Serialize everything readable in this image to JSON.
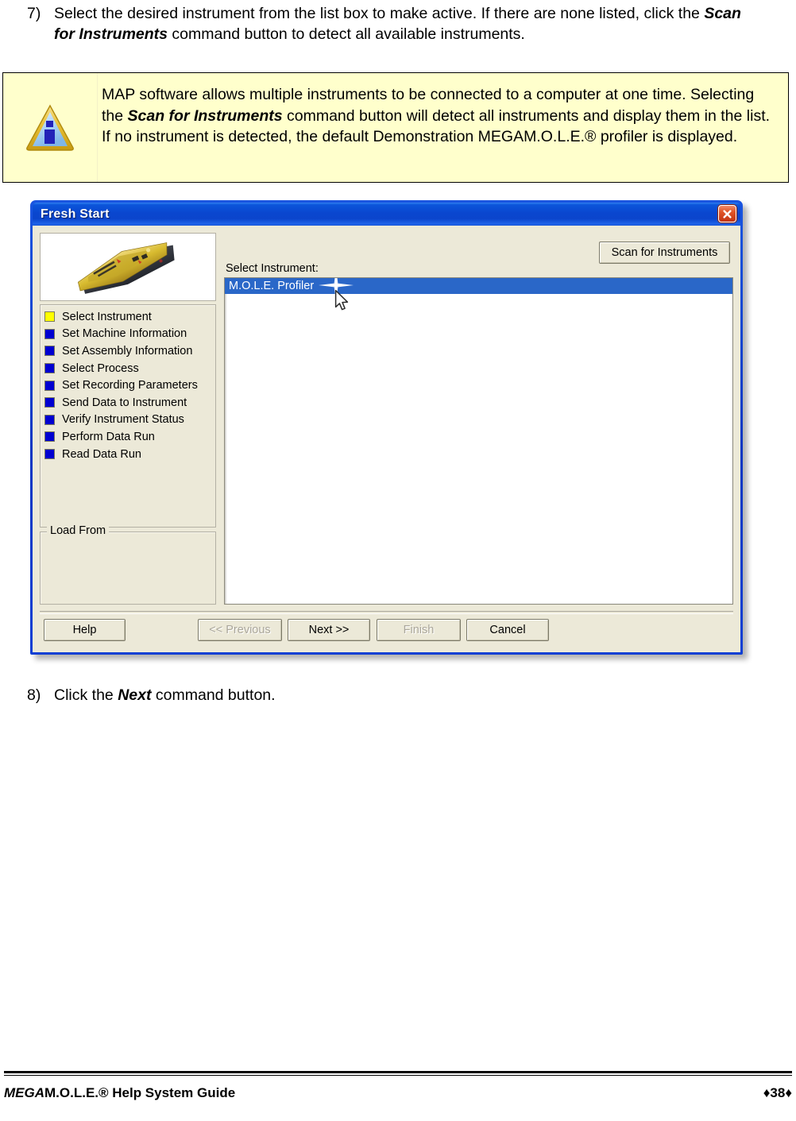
{
  "steps": [
    {
      "number": "7)",
      "text_1": "Select the desired instrument from the list box to make active. If there are none listed, click the ",
      "emphasis": "Scan for Instruments",
      "text_2": " command button to detect all available instruments."
    },
    {
      "number": "8)",
      "text_1": "Click the ",
      "emphasis": "Next",
      "text_2": " command button."
    }
  ],
  "note": {
    "icon": "info-triangle-icon",
    "text_1": "MAP software allows multiple instruments to be connected to a computer at one time. Selecting the ",
    "emphasis": "Scan for Instruments",
    "text_2": " command button will detect all instruments and display them in the list. If no instrument is detected, the default Demonstration MEGAM.O.L.E.® profiler is displayed.",
    "background_color": "#ffffcc",
    "border_color": "#000000"
  },
  "dialog": {
    "title": "Fresh Start",
    "close_icon": "close-icon",
    "titlebar_color": "#0b45cc",
    "face_color": "#ece9d8",
    "thumbnail_icon": "mole-profiler-device-image",
    "step_list": {
      "active_color": "#ffff00",
      "inactive_color": "#0000d0",
      "items": [
        {
          "label": "Select Instrument",
          "state": "active"
        },
        {
          "label": "Set Machine Information",
          "state": "pending"
        },
        {
          "label": "Set Assembly Information",
          "state": "pending"
        },
        {
          "label": "Select Process",
          "state": "pending"
        },
        {
          "label": "Set Recording Parameters",
          "state": "pending"
        },
        {
          "label": "Send Data to Instrument",
          "state": "pending"
        },
        {
          "label": "Verify Instrument Status",
          "state": "pending"
        },
        {
          "label": "Perform Data Run",
          "state": "pending"
        },
        {
          "label": "Read Data Run",
          "state": "pending"
        }
      ]
    },
    "load_from": {
      "legend": "Load From",
      "value": ""
    },
    "select_instrument": {
      "label": "Select Instrument:",
      "scan_button": "Scan for Instruments",
      "list_items": [
        {
          "label": "M.O.L.E. Profiler",
          "selected": true
        }
      ],
      "selection_color": "#2a67c8"
    },
    "buttons": {
      "help": {
        "label": "Help",
        "enabled": true
      },
      "previous": {
        "label": "<< Previous",
        "enabled": false
      },
      "next": {
        "label": "Next >>",
        "enabled": true
      },
      "finish": {
        "label": "Finish",
        "enabled": false
      },
      "cancel": {
        "label": "Cancel",
        "enabled": true
      }
    },
    "cursor_icon": "mouse-pointer-icon",
    "sparkle_icon": "sparkle-icon"
  },
  "footer": {
    "title_italic": "MEGA",
    "title_rest": "M.O.L.E.® Help System Guide",
    "page_number": "♦38♦"
  }
}
